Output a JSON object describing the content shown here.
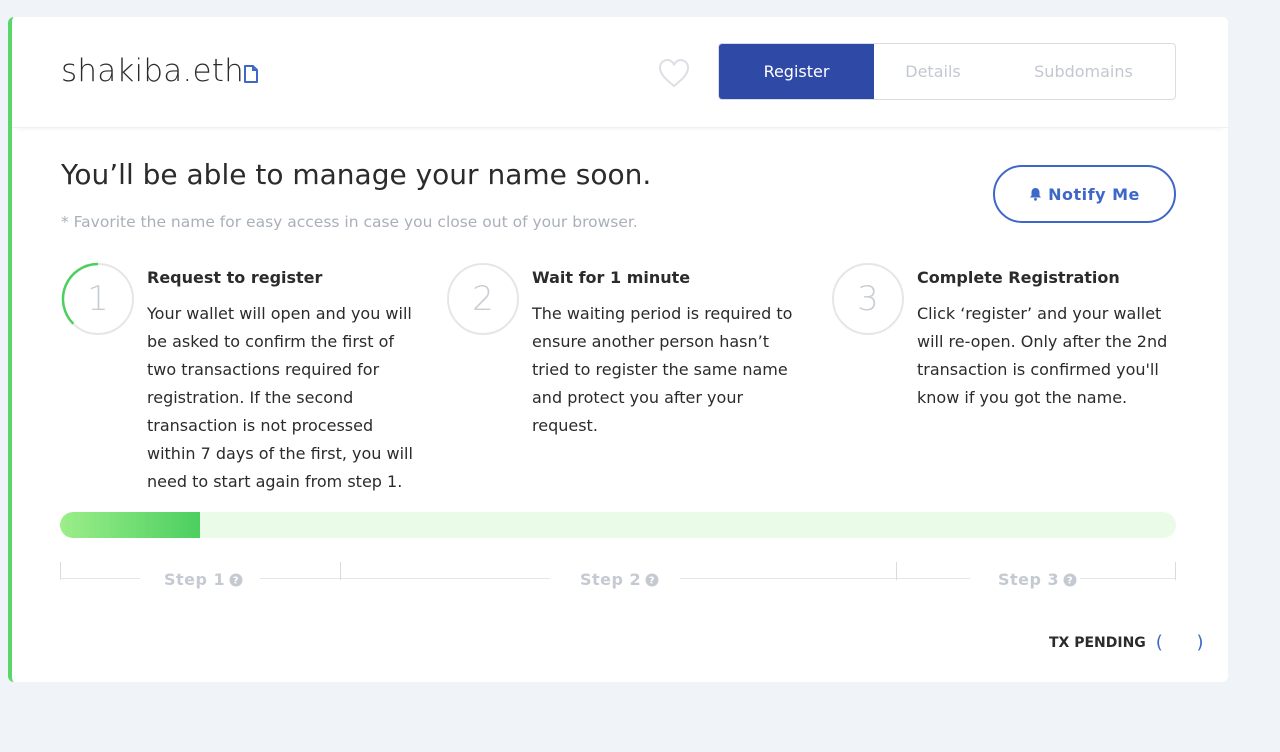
{
  "header": {
    "domain_name": "shakiba.eth",
    "tabs": [
      {
        "label": "Register",
        "active": true
      },
      {
        "label": "Details",
        "active": false
      },
      {
        "label": "Subdomains",
        "active": false
      }
    ]
  },
  "main": {
    "headline": "You’ll be able to manage your name soon.",
    "subnote": "* Favorite the name for easy access in case you close out of your browser.",
    "notify_button": "Notify Me",
    "steps": [
      {
        "number": "1",
        "title": "Request to register",
        "description": "Your wallet will open and you will be asked to confirm the first of two transactions required for registration. If the second transaction is not processed within 7 days of the first, you will need to start again from step 1."
      },
      {
        "number": "2",
        "title": "Wait for 1 minute",
        "description": "The waiting period is required to ensure another person hasn’t tried to register the same name and protect you after your request."
      },
      {
        "number": "3",
        "title": "Complete Registration",
        "description": "Click ‘register’ and your wallet will re-open. Only after the 2nd transaction is confirmed you'll know if you got the name."
      }
    ],
    "progress_fraction": 0.125,
    "step_labels": [
      "Step 1",
      "Step 2",
      "Step 3"
    ],
    "tx_status": "TX PENDING",
    "spinner": "( )"
  },
  "colors": {
    "accent": "#2f4aa6",
    "link": "#3e67c8",
    "success": "#4ccf5f",
    "progress_track": "#eafbe8"
  },
  "icons": [
    "copy-icon",
    "heart-icon",
    "bell-icon",
    "help-icon",
    "loading-spinner"
  ]
}
